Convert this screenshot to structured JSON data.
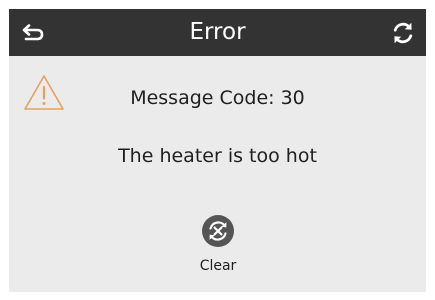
{
  "header": {
    "title": "Error",
    "back_icon": "back-arrow-icon",
    "refresh_icon": "refresh-icon",
    "background_color": "#333333"
  },
  "alert": {
    "icon": "warning-icon",
    "icon_color": "#e8a15a",
    "message_code": "Message Code: 30",
    "message": "The heater is too hot"
  },
  "actions": {
    "clear_label": "Clear",
    "clear_icon": "clear-icon"
  }
}
